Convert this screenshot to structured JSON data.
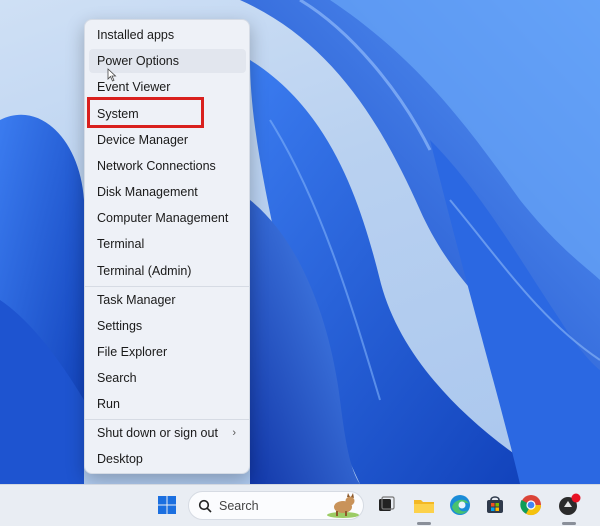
{
  "menu": {
    "items": [
      {
        "label": "Installed apps"
      },
      {
        "label": "Power Options"
      },
      {
        "label": "Event Viewer"
      },
      {
        "label": "System"
      },
      {
        "label": "Device Manager"
      },
      {
        "label": "Network Connections"
      },
      {
        "label": "Disk Management"
      },
      {
        "label": "Computer Management"
      },
      {
        "label": "Terminal"
      },
      {
        "label": "Terminal (Admin)"
      },
      {
        "label": "Task Manager"
      },
      {
        "label": "Settings"
      },
      {
        "label": "File Explorer"
      },
      {
        "label": "Search"
      },
      {
        "label": "Run"
      },
      {
        "label": "Shut down or sign out",
        "chevron": "›"
      },
      {
        "label": "Desktop"
      }
    ]
  },
  "annotation": {
    "highlighted_item": "System",
    "highlight_color": "#d9201e"
  },
  "taskbar": {
    "search_placeholder": "Search",
    "icons": [
      "windows-start-icon",
      "search-icon",
      "search-highlight-icon",
      "task-view-icon",
      "file-explorer-icon",
      "edge-icon",
      "store-icon",
      "chrome-icon",
      "app-icon"
    ],
    "badge_color": "#e81123"
  },
  "colors": {
    "accent": "#1a5fd8",
    "wallpaper_blue": "#1f5fe0"
  }
}
